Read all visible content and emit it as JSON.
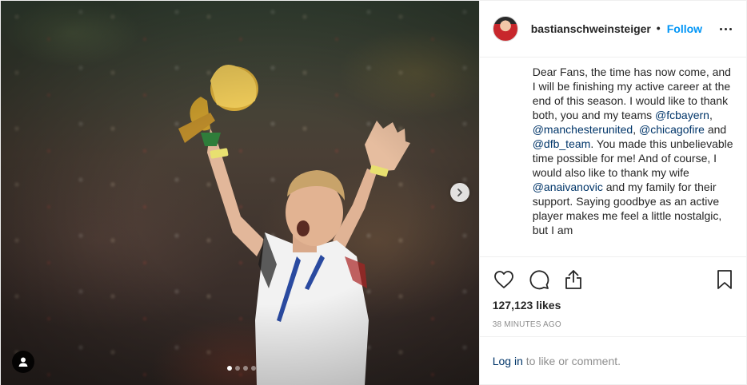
{
  "post": {
    "media": {
      "carousel": {
        "total": 4,
        "active_index": 0
      },
      "icons": {
        "next": "chevron-right-icon",
        "tags": "person-icon"
      }
    },
    "header": {
      "username": "bastianschweinsteiger",
      "separator": "•",
      "follow_label": "Follow",
      "more_icon": "ellipsis-icon"
    },
    "caption": {
      "part1": "Dear Fans, the time has now come, and I will be finishing my active career at the end of this season. I would like to thank both, you and my teams ",
      "mention1": "@fcbayern",
      "part2": ", ",
      "mention2": "@manchesterunited",
      "part3": ", ",
      "mention3": "@chicagofire",
      "part4": " and ",
      "mention4": "@dfb_team",
      "part5": ". You made this unbelievable time possible for me! And of course, I would also like to thank my wife ",
      "mention5": "@anaivanovic",
      "part6": " and my family for their support. Saying goodbye as an active player makes me feel a little nostalgic, but I am"
    },
    "actions": {
      "icons": [
        "heart-icon",
        "comment-icon",
        "share-icon",
        "bookmark-icon"
      ]
    },
    "likes_text": "127,123 likes",
    "timestamp": "38 MINUTES AGO",
    "comment": {
      "login_label": "Log in",
      "suffix": " to like or comment."
    },
    "colors": {
      "accent": "#0095f6",
      "mention": "#003569",
      "text": "#262626",
      "muted": "#8e8e8e",
      "border": "#efefef"
    }
  }
}
